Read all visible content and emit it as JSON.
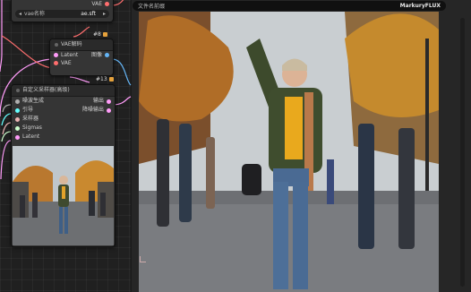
{
  "nodes": {
    "vae_loader": {
      "output_label": "VAE",
      "widget_label": "vae名称",
      "widget_value": "ae.sft"
    },
    "vae_decode": {
      "badge": "#8",
      "title": "VAE解码",
      "inputs": [
        "Latent",
        "VAE"
      ],
      "output_label": "图像"
    },
    "sampler": {
      "badge": "#13",
      "title": "自定义采样器(高级)",
      "inputs": [
        "噪波生成",
        "引导",
        "采样器",
        "Sigmas",
        "Latent"
      ],
      "outputs": [
        "输出",
        "降噪输出"
      ]
    }
  },
  "preview": {
    "header_title": "文件名前缀",
    "header_value": "MarkuryFLUX"
  },
  "colors": {
    "latent": "#ff9cf9",
    "vae": "#ff6e6e",
    "image": "#64b5f6",
    "noise": "#b0b0b0",
    "guider": "#66ffff",
    "sampler": "#ecb4b4",
    "sigmas": "#cdffcd",
    "badge": "#e6a23c"
  }
}
